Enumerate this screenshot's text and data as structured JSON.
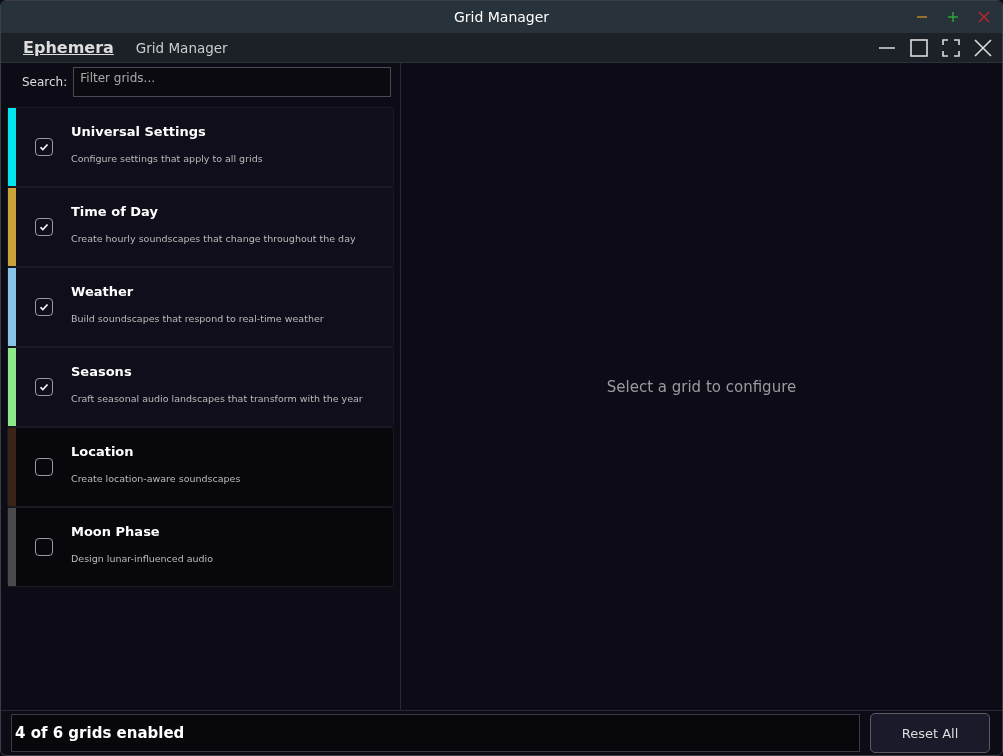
{
  "window": {
    "title": "Grid Manager"
  },
  "header": {
    "app_name": "Ephemera",
    "page_title": "Grid Manager"
  },
  "search": {
    "label": "Search:",
    "placeholder": "Filter grids..."
  },
  "grids": [
    {
      "name": "Universal Settings",
      "description": "Configure settings that apply to all grids",
      "color": "#00e5ee",
      "checked": true
    },
    {
      "name": "Time of Day",
      "description": "Create hourly soundscapes that change throughout the day",
      "color": "#c9a23a",
      "checked": true
    },
    {
      "name": "Weather",
      "description": "Build soundscapes that respond to real-time weather",
      "color": "#87c3e6",
      "checked": true
    },
    {
      "name": "Seasons",
      "description": "Craft seasonal audio landscapes that transform with the year",
      "color": "#8ee88a",
      "checked": true
    },
    {
      "name": "Location",
      "description": "Create location-aware soundscapes",
      "color": "#3a2418",
      "checked": false
    },
    {
      "name": "Moon Phase",
      "description": "Design lunar-influenced audio",
      "color": "#4a4a4a",
      "checked": false
    }
  ],
  "detail": {
    "empty_message": "Select a grid to configure"
  },
  "status_bar": {
    "summary": "4 of 6 grids enabled",
    "reset_button": "Reset All"
  }
}
